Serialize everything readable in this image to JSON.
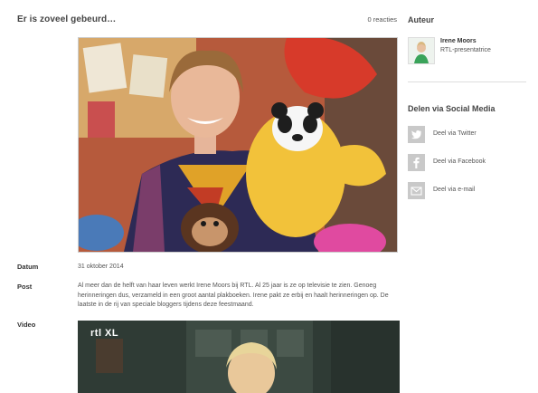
{
  "article": {
    "title": "Er is zoveel gebeurd…",
    "reactions": "0 reacties",
    "date_label": "Datum",
    "date_value": "31 oktober 2014",
    "post_label": "Post",
    "post_text": "Al meer dan de helft van haar leven werkt Irene Moors bij RTL. Al 25 jaar is ze op televisie te zien. Genoeg herinneringen dus, verzameld in een groot aantal plakboeken. Irene pakt ze erbij en haalt herinneringen op. De laatste in de rij van speciale bloggers tijdens deze feestmaand.",
    "video_label": "Video",
    "video_logo": "rtl XL"
  },
  "sidebar": {
    "author_heading": "Auteur",
    "author_name": "Irene Moors",
    "author_role": "RTL-presentatrice",
    "share_heading": "Delen via Social Media",
    "share": [
      {
        "label": "Deel via Twitter",
        "icon": "twitter-icon"
      },
      {
        "label": "Deel via Facebook",
        "icon": "facebook-icon"
      },
      {
        "label": "Deel via e-mail",
        "icon": "email-icon"
      }
    ]
  },
  "colors": {
    "icon_bg": "#c9c9c9",
    "divider": "#dddddd",
    "video_bg": "#2d3a34"
  }
}
